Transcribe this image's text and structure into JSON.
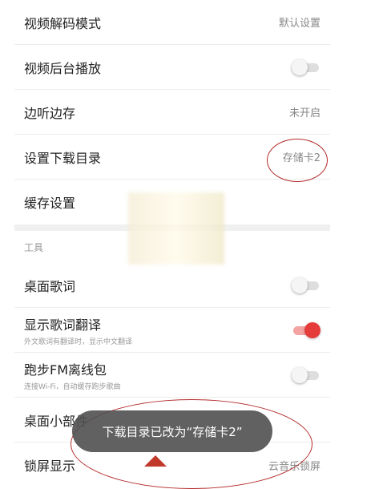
{
  "settings": {
    "rows_top": [
      {
        "label": "视频解码模式",
        "value": "默认设置"
      },
      {
        "label": "视频后台播放",
        "value": ""
      },
      {
        "label": "边听边存",
        "value": "未开启"
      },
      {
        "label": "设置下载目录",
        "value": "存储卡2"
      },
      {
        "label": "缓存设置",
        "value": ""
      }
    ],
    "section_label": "工具",
    "rows_bottom": [
      {
        "label": "桌面歌词",
        "sub": ""
      },
      {
        "label": "显示歌词翻译",
        "sub": "外文歌词有翻译时，显示中文翻译"
      },
      {
        "label": "跑步FM离线包",
        "sub": "连接Wi-Fi，自动缓存跑步歌曲"
      },
      {
        "label": "桌面小部件",
        "sub": ""
      },
      {
        "label": "锁屏显示",
        "value": "云音乐锁屏"
      }
    ]
  },
  "toggles": {
    "video_background": "off",
    "desktop_lyrics": "off",
    "lyrics_translation": "on",
    "running_fm": "off"
  },
  "toast": {
    "text": "下载目录已改为“存储卡2”"
  },
  "colors": {
    "accent": "#e63b3b",
    "annotation": "#b42a2a"
  }
}
